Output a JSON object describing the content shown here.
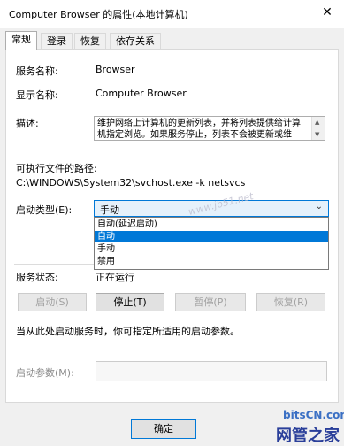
{
  "window": {
    "title": "Computer Browser 的属性(本地计算机)",
    "close_glyph": "✕"
  },
  "tabs": [
    {
      "label": "常规",
      "active": true
    },
    {
      "label": "登录",
      "active": false
    },
    {
      "label": "恢复",
      "active": false
    },
    {
      "label": "依存关系",
      "active": false
    }
  ],
  "general": {
    "service_name_label": "服务名称:",
    "service_name": "Browser",
    "display_name_label": "显示名称:",
    "display_name": "Computer Browser",
    "description_label": "描述:",
    "description": "维护网络上计算机的更新列表，并将列表提供给计算机指定浏览。如果服务停止，列表不会被更新或维护。如",
    "exe_path_label": "可执行文件的路径:",
    "exe_path": "C:\\WINDOWS\\System32\\svchost.exe -k netsvcs",
    "startup_type_label": "启动类型(E):",
    "startup_type_value": "手动",
    "startup_options": [
      {
        "label": "自动(延迟启动)",
        "selected": false
      },
      {
        "label": "自动",
        "selected": true
      },
      {
        "label": "手动",
        "selected": false
      },
      {
        "label": "禁用",
        "selected": false
      }
    ],
    "service_status_label": "服务状态:",
    "service_status": "正在运行",
    "buttons": {
      "start": "启动(S)",
      "stop": "停止(T)",
      "pause": "暂停(P)",
      "resume": "恢复(R)"
    },
    "hint": "当从此处启动服务时，你可指定所适用的启动参数。",
    "start_params_label": "启动参数(M):",
    "start_params_value": ""
  },
  "footer": {
    "ok": "确定"
  },
  "watermarks": {
    "url": "www.jb51.net",
    "brand_en": "bitsCN.com",
    "brand_cn": "网管之家"
  },
  "colors": {
    "accent": "#0078d7",
    "panel_bg": "#ffffff",
    "dialog_bg": "#f0f0f0"
  }
}
